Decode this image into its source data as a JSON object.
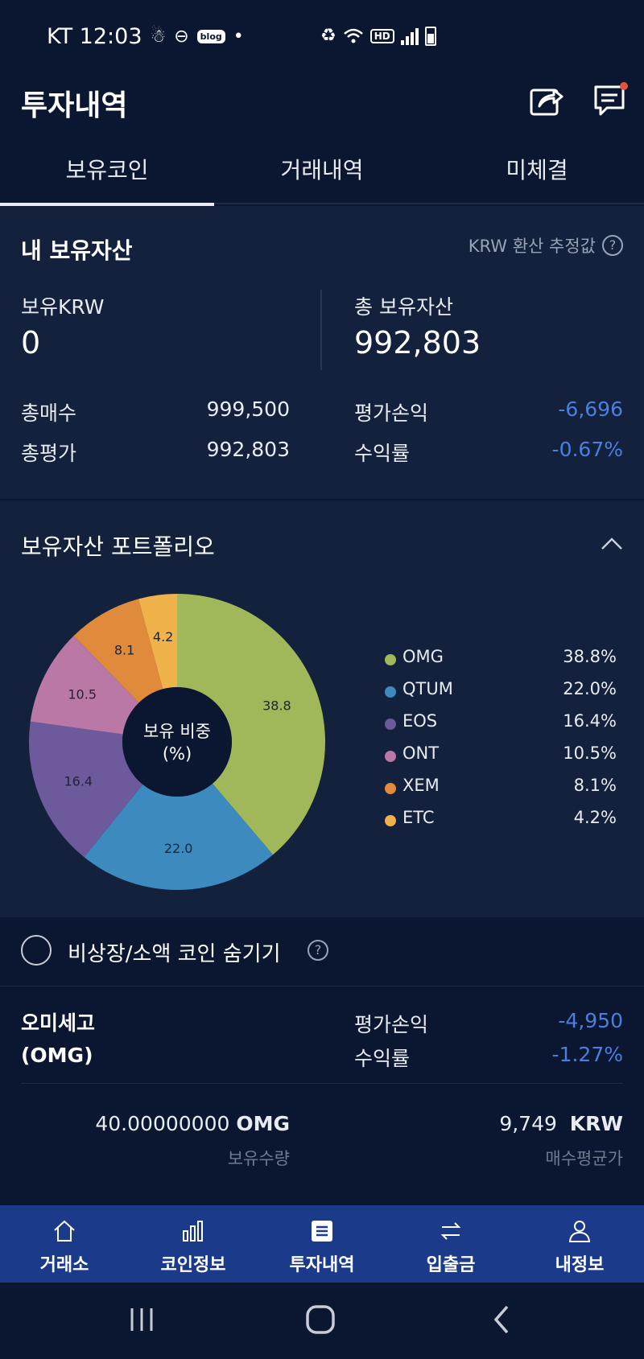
{
  "status_bar": {
    "carrier_time": "KT 12:03",
    "blog_badge": "blog",
    "hd_badge": "HD"
  },
  "header": {
    "title": "투자내역"
  },
  "tabs": [
    {
      "label": "보유코인",
      "active": true
    },
    {
      "label": "거래내역",
      "active": false
    },
    {
      "label": "미체결",
      "active": false
    }
  ],
  "assets": {
    "title": "내 보유자산",
    "krw_note": "KRW 환산 추정값",
    "krw_label": "보유KRW",
    "krw_value": "0",
    "total_label": "총 보유자산",
    "total_value": "992,803",
    "buy_label": "총매수",
    "buy_value": "999,500",
    "eval_label": "총평가",
    "eval_value": "992,803",
    "pl_label": "평가손익",
    "pl_value": "-6,696",
    "rate_label": "수익률",
    "rate_value": "-0.67%"
  },
  "portfolio": {
    "title": "보유자산 포트폴리오",
    "center_line1": "보유 비중",
    "center_line2": "(%)",
    "chart_data": {
      "type": "pie",
      "categories": [
        "OMG",
        "QTUM",
        "EOS",
        "ONT",
        "XEM",
        "ETC"
      ],
      "values": [
        38.8,
        22.0,
        16.4,
        10.5,
        8.1,
        4.2
      ],
      "slice_labels": [
        "38.8",
        "22.0",
        "16.4",
        "10.5",
        "8.1",
        "4.2"
      ],
      "legend_values": [
        "38.8%",
        "22.0%",
        "16.4%",
        "10.5%",
        "8.1%",
        "4.2%"
      ],
      "colors": [
        "#a1b85a",
        "#3d8abf",
        "#6d5a9c",
        "#b978a6",
        "#e08a3c",
        "#f0b24b"
      ],
      "legend": "right"
    }
  },
  "hide_small": {
    "label": "비상장/소액 코인 숨기기"
  },
  "coin": {
    "name_line1": "오미세고",
    "name_line2": "(OMG)",
    "pl_label": "평가손익",
    "pl_value": "-4,950",
    "rate_label": "수익률",
    "rate_value": "-1.27%",
    "qty_value": "40.00000000",
    "qty_unit": "OMG",
    "qty_label": "보유수량",
    "avg_value": "9,749",
    "avg_unit": "KRW",
    "avg_label": "매수평균가"
  },
  "bottom_nav": [
    {
      "label": "거래소",
      "icon": "home-icon"
    },
    {
      "label": "코인정보",
      "icon": "bar-chart-icon"
    },
    {
      "label": "투자내역",
      "icon": "list-icon",
      "active": true
    },
    {
      "label": "입출금",
      "icon": "transfer-icon"
    },
    {
      "label": "내정보",
      "icon": "person-icon"
    }
  ],
  "theme": {
    "background": "#0b1730",
    "panel": "#13213d",
    "negative": "#4a7fe0",
    "nav": "#1c3a8a"
  }
}
